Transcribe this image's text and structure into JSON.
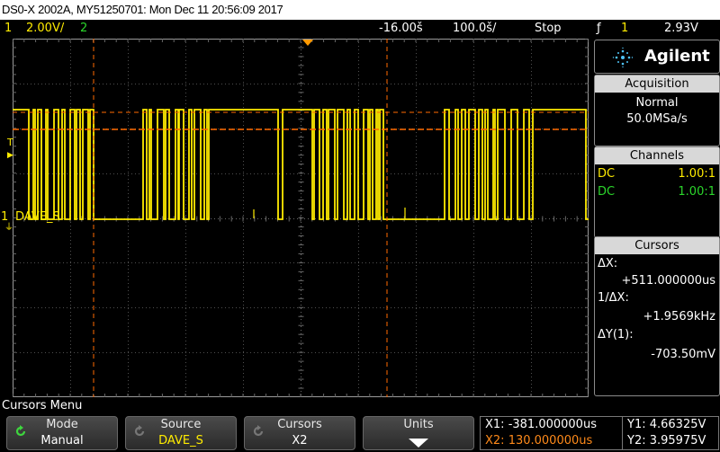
{
  "title": "DS0-X 2002A, MY51250701: Mon Dec 11 20:56:09 2017",
  "status": {
    "ch1_num": "1",
    "ch1_scale": "2.00V/",
    "ch2_num": "2",
    "time_offset": "-16.00š",
    "time_scale": "100.0š/",
    "run_state": "Stop",
    "trigger_icon": "ƒ",
    "trigger_channel": "1",
    "trigger_level": "2.93V"
  },
  "brand": "Agilent",
  "acquisition": {
    "header": "Acquisition",
    "mode": "Normal",
    "rate": "50.0MSa/s"
  },
  "channels": {
    "header": "Channels",
    "rows": [
      {
        "coupling": "DC",
        "ratio": "1.00:1",
        "color": "#ffec00"
      },
      {
        "coupling": "DC",
        "ratio": "1.00:1",
        "color": "#2bd62b"
      }
    ]
  },
  "cursors": {
    "header": "Cursors",
    "dx_label": "ΔX:",
    "dx_value": "+511.000000us",
    "inv_dx_label": "1/ΔX:",
    "inv_dx_value": "+1.9569kHz",
    "dy_label": "ΔY(1):",
    "dy_value": "-703.50mV"
  },
  "screen": {
    "channel_label": "DAVE_S",
    "ground_marker": "1",
    "trigger_marker": "T"
  },
  "menu": {
    "title": "Cursors Menu",
    "softkeys": [
      {
        "top": "Mode",
        "bottom": "Manual",
        "icon": "cycle-icon"
      },
      {
        "top": "Source",
        "bottom": "DAVE_S",
        "icon": "cycle-icon"
      },
      {
        "top": "Cursors",
        "bottom": "X2",
        "icon": "cycle-icon"
      },
      {
        "top": "Units",
        "bottom": "",
        "icon": "down-arrow-icon"
      }
    ]
  },
  "cursor_readout": {
    "x1": "X1: -381.000000us",
    "x2": "X2: 130.000000us",
    "y1": "Y1: 4.66325V",
    "y2": "Y2: 3.95975V"
  },
  "colors": {
    "ch1": "#ffec00",
    "ch2": "#2bd62b",
    "x1_cursor": "#ff6a00",
    "x2_cursor": "#ff6a00",
    "grid": "#4f4f4f",
    "header_bg": "#d8d8d8"
  }
}
